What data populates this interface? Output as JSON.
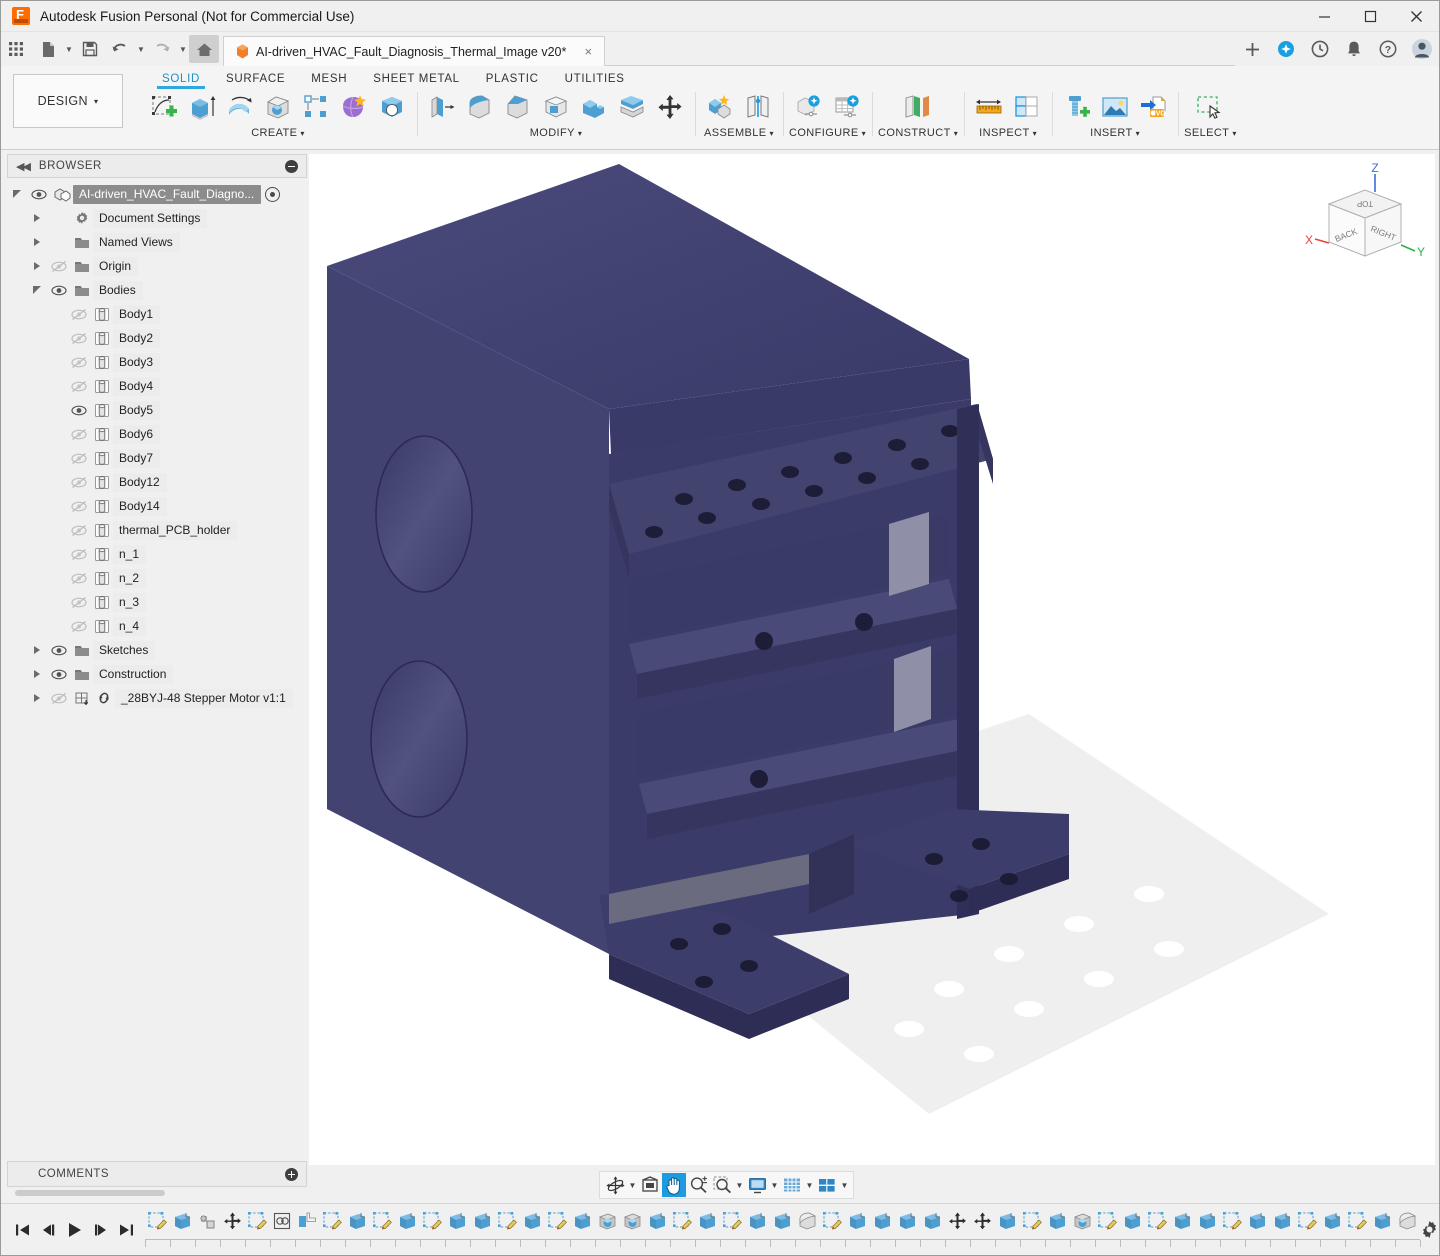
{
  "window": {
    "title": "Autodesk Fusion Personal (Not for Commercial Use)",
    "minimize_label": "Minimize",
    "maximize_label": "Maximize",
    "close_label": "Close"
  },
  "quick_access": {
    "items": [
      {
        "name": "app-grid-icon",
        "label": "Show Data Panel"
      },
      {
        "name": "file-icon",
        "label": "File"
      },
      {
        "name": "save-icon",
        "label": "Save"
      },
      {
        "name": "undo-icon",
        "label": "Undo"
      },
      {
        "name": "redo-icon",
        "label": "Redo"
      },
      {
        "name": "home-icon",
        "label": "Home"
      }
    ]
  },
  "document_tab": {
    "title": "AI-driven_HVAC_Fault_Diagnosis_Thermal_Image v20*",
    "close_label": "×",
    "new_tab_label": "+"
  },
  "tab_right_icons": [
    {
      "name": "extensions-icon",
      "label": "Extensions"
    },
    {
      "name": "recent-icon",
      "label": "Recent"
    },
    {
      "name": "notifications-bell-icon",
      "label": "Notifications"
    },
    {
      "name": "help-icon",
      "label": "Help"
    },
    {
      "name": "user-avatar",
      "label": "Account"
    }
  ],
  "workspace": {
    "label": "DESIGN",
    "caret": "▾"
  },
  "ribbon": {
    "tabs": [
      {
        "label": "SOLID",
        "active": true
      },
      {
        "label": "SURFACE",
        "active": false
      },
      {
        "label": "MESH",
        "active": false
      },
      {
        "label": "SHEET METAL",
        "active": false
      },
      {
        "label": "PLASTIC",
        "active": false
      },
      {
        "label": "UTILITIES",
        "active": false
      }
    ],
    "panels": [
      {
        "label": "CREATE",
        "caret": "▾",
        "tools": [
          "create-sketch-icon",
          "extrude-icon",
          "revolve-icon",
          "hole-icon",
          "rectangular-pattern-icon",
          "create-form-icon",
          "cylinder-icon"
        ]
      },
      {
        "label": "MODIFY",
        "caret": "▾",
        "tools": [
          "press-pull-icon",
          "fillet-icon",
          "chamfer-icon",
          "shell-icon",
          "combine-icon",
          "split-face-icon",
          "move-copy-icon"
        ]
      },
      {
        "label": "ASSEMBLE",
        "caret": "▾",
        "tools": [
          "new-component-icon",
          "joint-icon"
        ]
      },
      {
        "label": "CONFIGURE",
        "caret": "▾",
        "tools": [
          "create-configuration-icon",
          "configuration-table-icon"
        ]
      },
      {
        "label": "CONSTRUCT",
        "caret": "▾",
        "tools": [
          "offset-plane-icon"
        ]
      },
      {
        "label": "INSPECT",
        "caret": "▾",
        "tools": [
          "measure-icon",
          "section-analysis-icon"
        ]
      },
      {
        "label": "INSERT",
        "caret": "▾",
        "tools": [
          "insert-mcmaster-part-icon",
          "insert-canvas-icon",
          "insert-svg-icon"
        ]
      },
      {
        "label": "SELECT",
        "caret": "▾",
        "tools": [
          "select-window-icon"
        ]
      }
    ]
  },
  "browser": {
    "title": "BROWSER",
    "collapse_label": "◀◀",
    "minimize_label": "−",
    "root": {
      "label": "AI-driven_HVAC_Fault_Diagno...",
      "selected": true,
      "visible": true
    },
    "items": [
      {
        "label": "Document Settings",
        "indent": 1,
        "type": "gear",
        "twisty": "closed",
        "eye": "none"
      },
      {
        "label": "Named Views",
        "indent": 1,
        "type": "folder",
        "twisty": "closed",
        "eye": "none"
      },
      {
        "label": "Origin",
        "indent": 1,
        "type": "folder",
        "twisty": "closed",
        "eye": "hidden"
      },
      {
        "label": "Bodies",
        "indent": 1,
        "type": "folder",
        "twisty": "open",
        "eye": "visible"
      },
      {
        "label": "Body1",
        "indent": 2,
        "type": "body",
        "twisty": "none",
        "eye": "hidden"
      },
      {
        "label": "Body2",
        "indent": 2,
        "type": "body",
        "twisty": "none",
        "eye": "hidden"
      },
      {
        "label": "Body3",
        "indent": 2,
        "type": "body",
        "twisty": "none",
        "eye": "hidden"
      },
      {
        "label": "Body4",
        "indent": 2,
        "type": "body",
        "twisty": "none",
        "eye": "hidden"
      },
      {
        "label": "Body5",
        "indent": 2,
        "type": "body",
        "twisty": "none",
        "eye": "visible"
      },
      {
        "label": "Body6",
        "indent": 2,
        "type": "body",
        "twisty": "none",
        "eye": "hidden"
      },
      {
        "label": "Body7",
        "indent": 2,
        "type": "body",
        "twisty": "none",
        "eye": "hidden"
      },
      {
        "label": "Body12",
        "indent": 2,
        "type": "body",
        "twisty": "none",
        "eye": "hidden"
      },
      {
        "label": "Body14",
        "indent": 2,
        "type": "body",
        "twisty": "none",
        "eye": "hidden"
      },
      {
        "label": "thermal_PCB_holder",
        "indent": 2,
        "type": "body",
        "twisty": "none",
        "eye": "hidden"
      },
      {
        "label": "n_1",
        "indent": 2,
        "type": "body",
        "twisty": "none",
        "eye": "hidden"
      },
      {
        "label": "n_2",
        "indent": 2,
        "type": "body",
        "twisty": "none",
        "eye": "hidden"
      },
      {
        "label": "n_3",
        "indent": 2,
        "type": "body",
        "twisty": "none",
        "eye": "hidden"
      },
      {
        "label": "n_4",
        "indent": 2,
        "type": "body",
        "twisty": "none",
        "eye": "hidden"
      },
      {
        "label": "Sketches",
        "indent": 1,
        "type": "folder",
        "twisty": "closed",
        "eye": "visible"
      },
      {
        "label": "Construction",
        "indent": 1,
        "type": "folder",
        "twisty": "closed",
        "eye": "visible"
      },
      {
        "label": "_28BYJ-48 Stepper Motor v1:1",
        "indent": 1,
        "type": "component-link",
        "twisty": "closed",
        "eye": "hidden"
      }
    ]
  },
  "comments": {
    "title": "COMMENTS",
    "add_label": "+"
  },
  "viewcube": {
    "faces": {
      "top": "TOP",
      "front_right": "RIGHT",
      "front_left": "BACK"
    },
    "axes": {
      "x": "X",
      "y": "Y",
      "z": "Z"
    },
    "colors": {
      "x": "#ef4136",
      "y": "#29b24a",
      "z": "#3a6ed8"
    }
  },
  "canvas": {
    "model_name": "thermal_PCB_holder",
    "body_color": "#3c3c6e",
    "background": "#ffffff",
    "shadow_color": "#d8d8d8"
  },
  "navbar": {
    "items": [
      {
        "name": "orbit-icon",
        "label": "Orbit",
        "caret": true,
        "active": false
      },
      {
        "name": "look-at-icon",
        "label": "Look At",
        "caret": false,
        "active": false
      },
      {
        "name": "pan-hand-icon",
        "label": "Pan",
        "caret": false,
        "active": true
      },
      {
        "name": "zoom-icon",
        "label": "Zoom",
        "caret": false,
        "active": false
      },
      {
        "name": "zoom-window-icon",
        "label": "Zoom Window",
        "caret": true,
        "active": false
      },
      {
        "name": "display-settings-icon",
        "label": "Display Settings",
        "caret": true,
        "active": false
      },
      {
        "name": "grid-snaps-icon",
        "label": "Grid and Snaps",
        "caret": true,
        "active": false
      },
      {
        "name": "viewports-icon",
        "label": "Viewports",
        "caret": true,
        "active": false
      }
    ]
  },
  "timeline": {
    "playback": [
      {
        "name": "timeline-go-start-button",
        "label": "⏮"
      },
      {
        "name": "timeline-step-back-button",
        "label": "◀|"
      },
      {
        "name": "timeline-play-button",
        "label": "▶"
      },
      {
        "name": "timeline-step-forward-button",
        "label": "|▶"
      },
      {
        "name": "timeline-go-end-button",
        "label": "⏭"
      }
    ],
    "features": [
      "sketch",
      "extrude",
      "joint-origin",
      "move",
      "sketch",
      "rigid-group",
      "mirror",
      "sketch",
      "extrude",
      "sketch",
      "extrude",
      "sketch",
      "extrude",
      "extrude",
      "sketch",
      "extrude",
      "sketch",
      "extrude",
      "hole",
      "hole",
      "extrude",
      "sketch",
      "extrude",
      "sketch",
      "extrude",
      "extrude",
      "fillet",
      "sketch",
      "extrude",
      "extrude",
      "extrude",
      "extrude",
      "move",
      "move",
      "extrude",
      "sketch",
      "extrude",
      "hole",
      "sketch",
      "extrude",
      "sketch",
      "extrude",
      "extrude",
      "sketch",
      "extrude",
      "extrude",
      "sketch",
      "extrude",
      "sketch",
      "extrude",
      "fillet"
    ],
    "settings_label": "Timeline Settings"
  }
}
